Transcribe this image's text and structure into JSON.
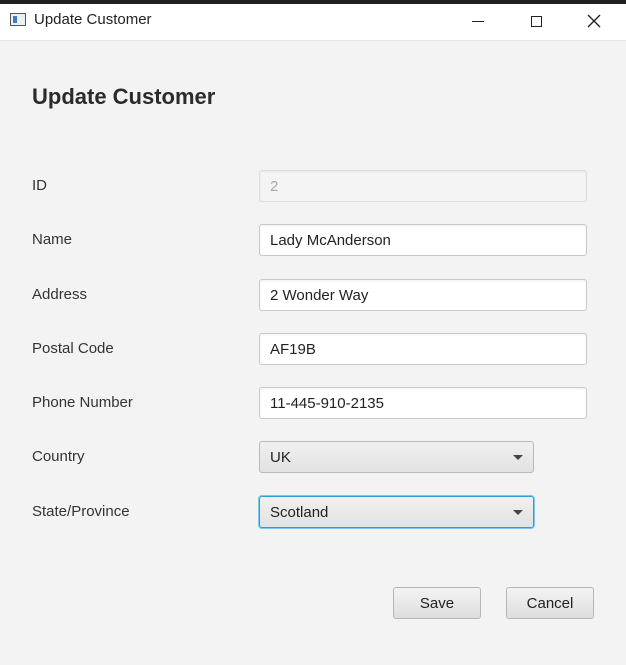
{
  "window": {
    "title": "Update Customer"
  },
  "heading": "Update Customer",
  "form": {
    "id": {
      "label": "ID",
      "value": "2"
    },
    "name": {
      "label": "Name",
      "value": "Lady McAnderson"
    },
    "address": {
      "label": "Address",
      "value": "2 Wonder Way"
    },
    "postal_code": {
      "label": "Postal Code",
      "value": "AF19B"
    },
    "phone": {
      "label": "Phone Number",
      "value": "11-445-910-2135"
    },
    "country": {
      "label": "Country",
      "selected": "UK"
    },
    "state": {
      "label": "State/Province",
      "selected": "Scotland"
    }
  },
  "actions": {
    "save_label": "Save",
    "cancel_label": "Cancel"
  },
  "icons": {
    "app": "app-window-icon",
    "minimize": "minimize-icon",
    "maximize": "maximize-icon",
    "close": "close-icon",
    "dropdown": "chevron-down-icon"
  },
  "colors": {
    "background": "#f3f3f3",
    "focus_border": "#2a9fd6"
  }
}
